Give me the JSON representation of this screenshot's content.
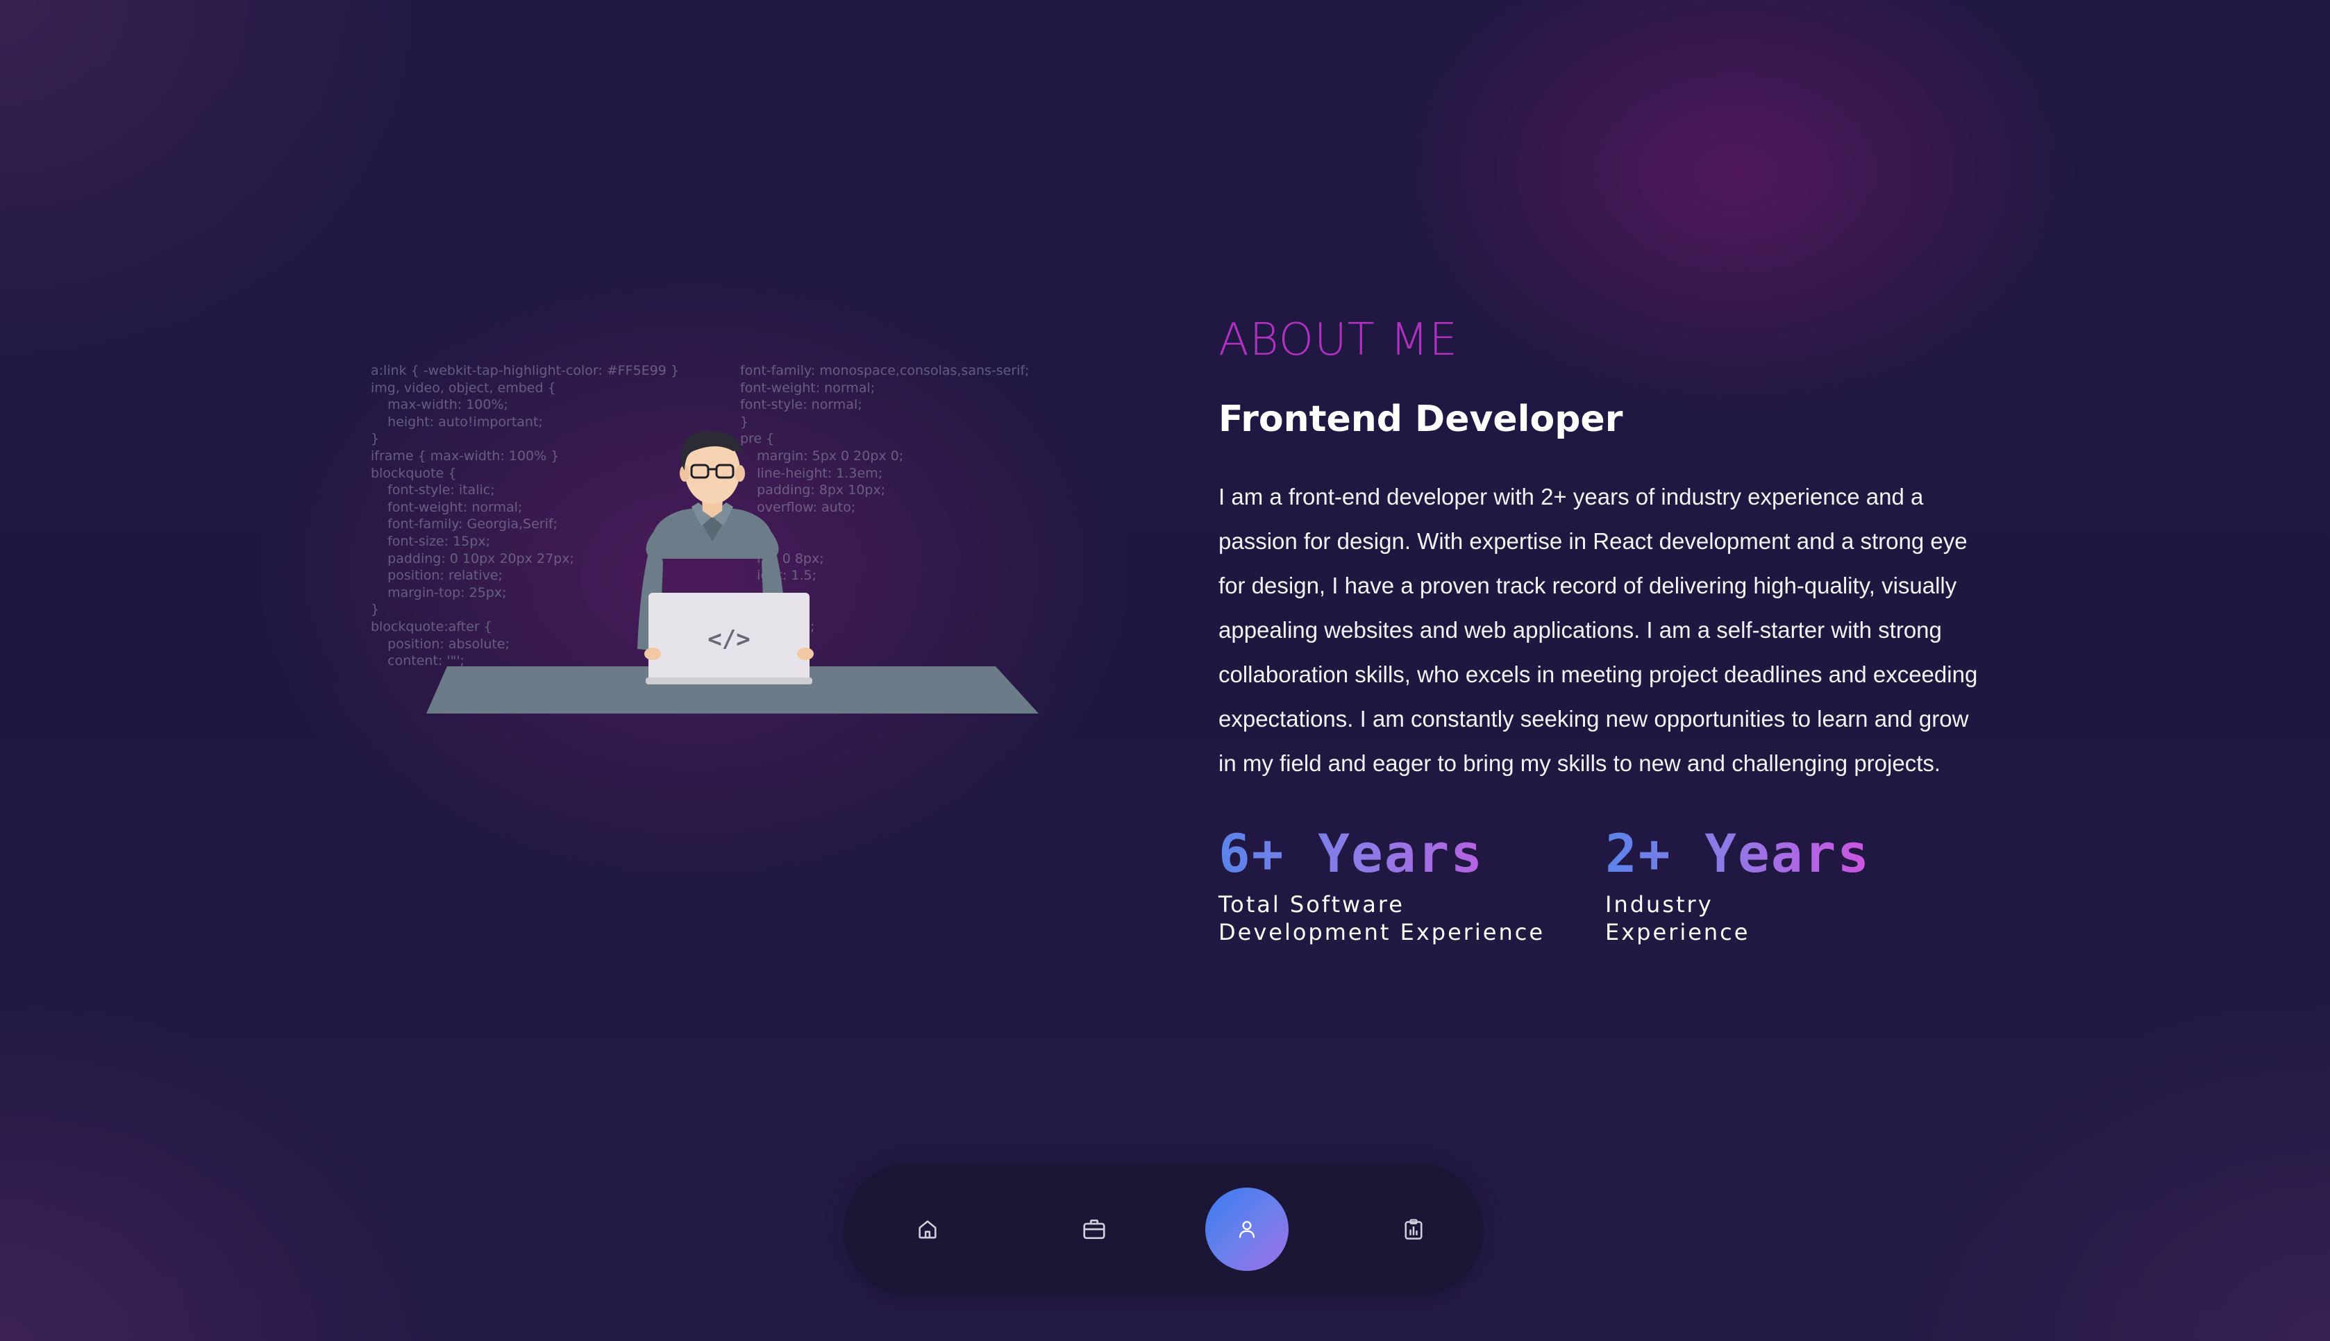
{
  "illustration": {
    "code_left": "a:link { -webkit-tap-highlight-color: #FF5E99 }\nimg, video, object, embed {\n    max-width: 100%;\n    height: auto!important;\n}\niframe { max-width: 100% }\nblockquote {\n    font-style: italic;\n    font-weight: normal;\n    font-family: Georgia,Serif;\n    font-size: 15px;\n    padding: 0 10px 20px 27px;\n    position: relative;\n    margin-top: 25px;\n}\nblockquote:after {\n    position: absolute;\n    content: '\"';",
    "code_right": "font-family: monospace,consolas,sans-serif;\nfont-weight: normal;\nfont-style: normal;\n}\npre {\n    margin: 5px 0 20px 0;\n    line-height: 1.3em;\n    padding: 8px 10px;\n    overflow: auto;\n}\n\n    ng: 0 8px;\n    ight: 1.5;\n\n\n    1px 6px;\n    0 2px;\n    lack",
    "laptop_symbol": "</>",
    "icon": "developer-at-laptop-icon"
  },
  "about": {
    "title": "ABOUT ME",
    "subtitle": "Frontend Developer",
    "description": "I am a front-end developer with 2+ years of industry experience and a passion for design. With expertise in React development and a strong eye for design, I have a proven track record of delivering high-quality, visually appealing websites and web applications. I am a self-starter with strong collaboration skills, who excels in meeting project deadlines and exceeding expectations. I am constantly seeking new opportunities to learn and grow in my field and eager to bring my skills to new and challenging projects.",
    "stats": [
      {
        "value": "6+ Years",
        "label": "Total Software\nDevelopment Experience"
      },
      {
        "value": "2+ Years",
        "label": "Industry\nExperience"
      }
    ]
  },
  "nav": {
    "items": [
      {
        "icon": "home-icon",
        "active": false
      },
      {
        "icon": "briefcase-icon",
        "active": false
      },
      {
        "icon": "user-icon",
        "active": true
      },
      {
        "icon": "clipboard-chart-icon",
        "active": false
      }
    ]
  },
  "colors": {
    "background": "#1e1840",
    "accent_title": "#b031bf",
    "stat_gradient_start": "#5b84ea",
    "stat_gradient_end": "#cc55e0",
    "nav_background": "#1b1536",
    "nav_active_start": "#3a7af0",
    "nav_active_end": "#a06fe8"
  }
}
